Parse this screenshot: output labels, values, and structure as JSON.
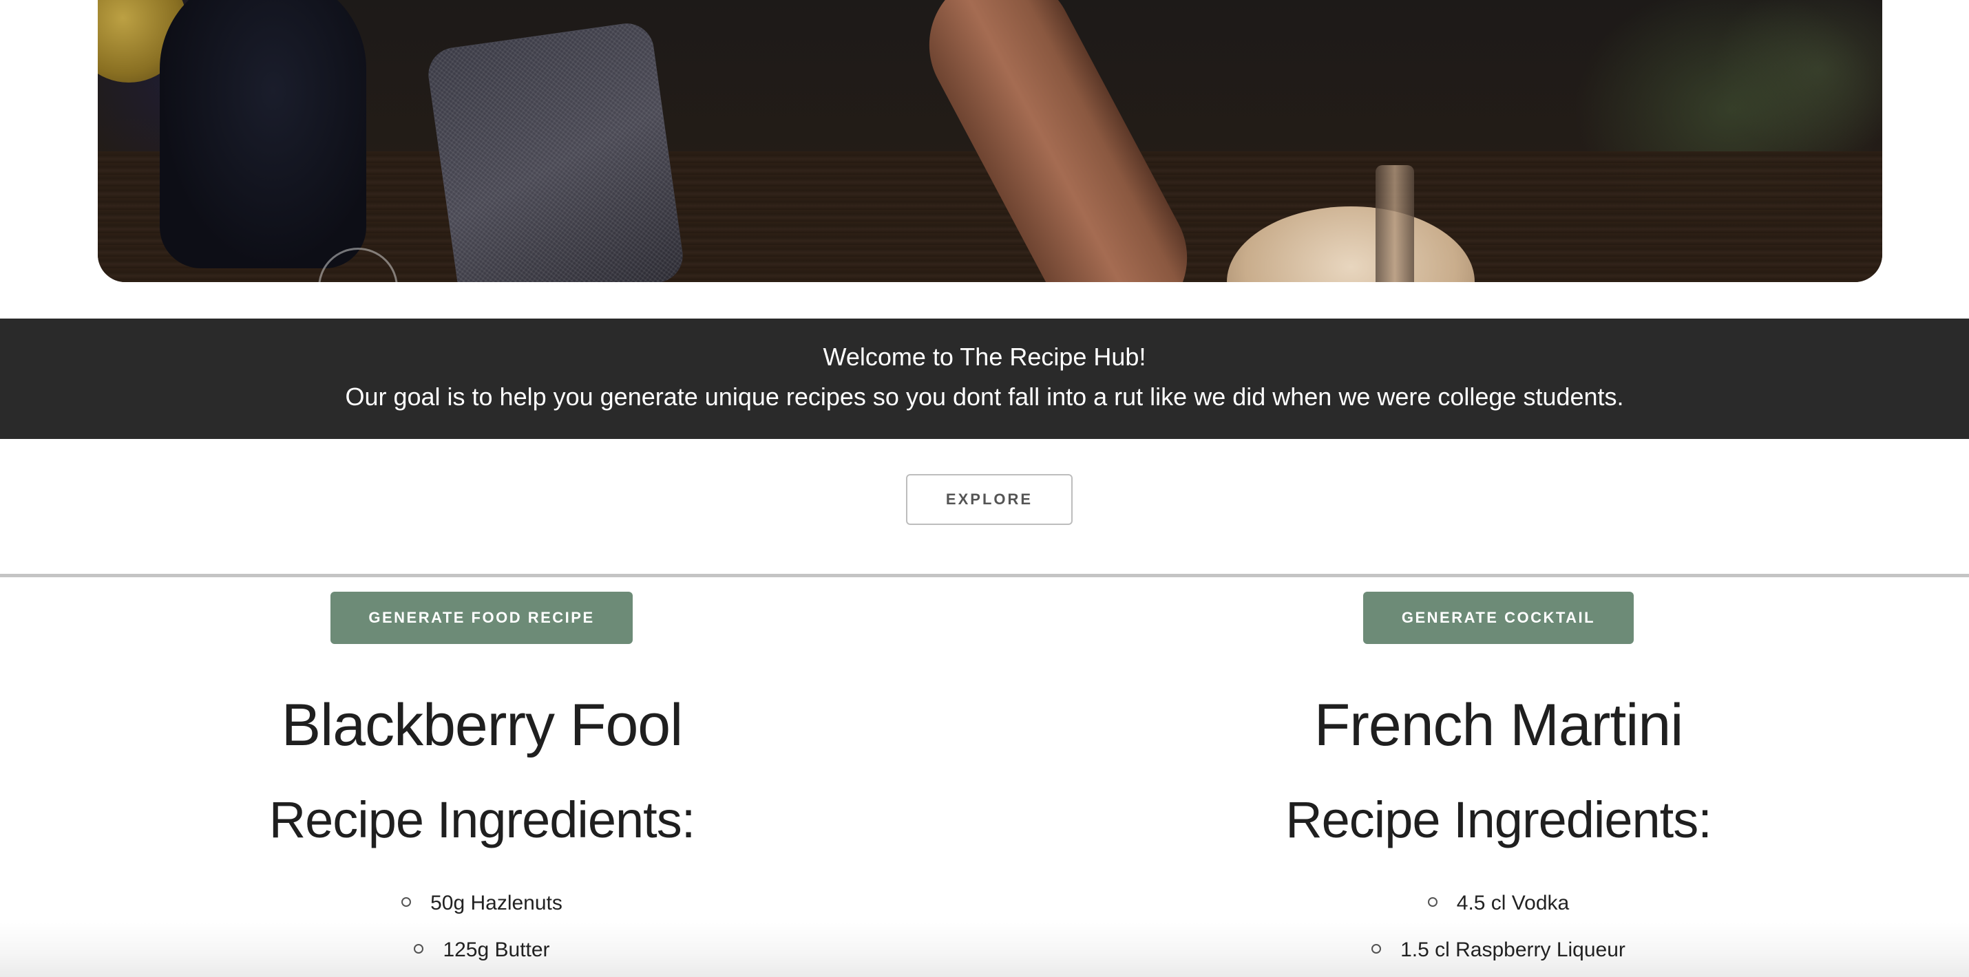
{
  "hero": {
    "image_name": "dinner-table-photo"
  },
  "banner": {
    "welcome": "Welcome to The Recipe Hub!",
    "goal": "Our goal is to help you generate unique recipes so you dont fall into a rut like we did when we were college students."
  },
  "explore_button": {
    "label": "EXPLORE"
  },
  "food": {
    "button_label": "GENERATE FOOD RECIPE",
    "title": "Blackberry Fool",
    "ingredients_heading": "Recipe Ingredients:",
    "ingredients": [
      "50g Hazlenuts",
      "125g Butter"
    ]
  },
  "cocktail": {
    "button_label": "GENERATE COCKTAIL",
    "title": "French Martini",
    "ingredients_heading": "Recipe Ingredients:",
    "ingredients": [
      "4.5 cl Vodka",
      "1.5 cl Raspberry Liqueur"
    ]
  },
  "colors": {
    "accent_green": "#6d8b77",
    "banner_dark": "#2a2a2a"
  }
}
